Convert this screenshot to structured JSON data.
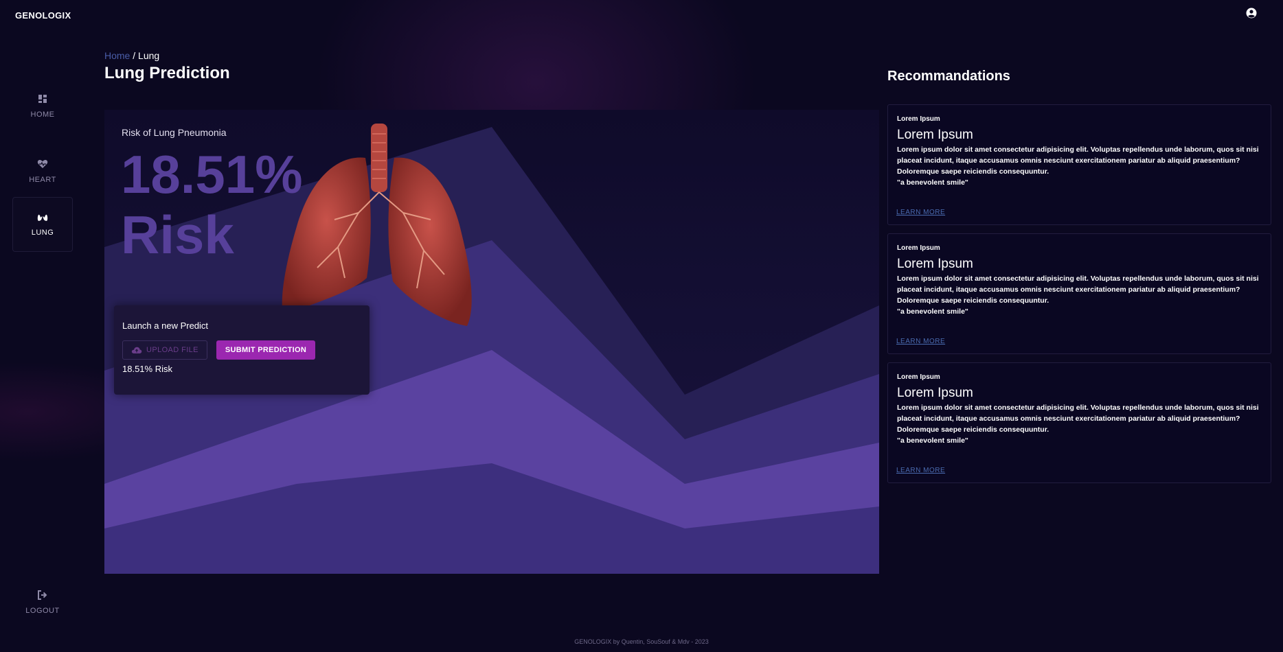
{
  "app": {
    "brand": "GENOLOGIX"
  },
  "sidebar": {
    "items": [
      {
        "label": "HOME",
        "icon": "dashboard-icon"
      },
      {
        "label": "HEART",
        "icon": "heart-pulse-icon"
      },
      {
        "label": "LUNG",
        "icon": "lungs-icon",
        "active": true
      }
    ],
    "logout": {
      "label": "LOGOUT",
      "icon": "logout-icon"
    }
  },
  "breadcrumb": {
    "home": "Home",
    "separator": " / ",
    "current": "Lung"
  },
  "page": {
    "title": "Lung Prediction"
  },
  "hero": {
    "risk_label": "Risk of Lung Pneumonia",
    "risk_value": "18.51%",
    "risk_word": "Risk"
  },
  "predict": {
    "title": "Launch a new Predict",
    "upload_label": "UPLOAD FILE",
    "submit_label": "SUBMIT PREDICTION",
    "result": "18.51% Risk"
  },
  "recommendations": {
    "title": "Recommandations",
    "cards": [
      {
        "kicker": "Lorem Ipsum",
        "heading": "Lorem Ipsum",
        "body": "Lorem ipsum dolor sit amet consectetur adipisicing elit. Voluptas repellendus unde laborum, quos sit nisi placeat incidunt, itaque accusamus omnis nesciunt exercitationem pariatur ab aliquid praesentium? Doloremque saepe reiciendis consequuntur.",
        "quote": "\"a benevolent smile\"",
        "link": "LEARN MORE"
      },
      {
        "kicker": "Lorem Ipsum",
        "heading": "Lorem Ipsum",
        "body": "Lorem ipsum dolor sit amet consectetur adipisicing elit. Voluptas repellendus unde laborum, quos sit nisi placeat incidunt, itaque accusamus omnis nesciunt exercitationem pariatur ab aliquid praesentium? Doloremque saepe reiciendis consequuntur.",
        "quote": "\"a benevolent smile\"",
        "link": "LEARN MORE"
      },
      {
        "kicker": "Lorem Ipsum",
        "heading": "Lorem Ipsum",
        "body": "Lorem ipsum dolor sit amet consectetur adipisicing elit. Voluptas repellendus unde laborum, quos sit nisi placeat incidunt, itaque accusamus omnis nesciunt exercitationem pariatur ab aliquid praesentium? Doloremque saepe reiciendis consequuntur.",
        "quote": "\"a benevolent smile\"",
        "link": "LEARN MORE"
      }
    ]
  },
  "footer": {
    "text": "GENOLOGIX by Quentin, SouSouf & Mdv - 2023"
  },
  "colors": {
    "background": "#0b0820",
    "accent": "#9b27b0",
    "risk_text": "#57409a",
    "link": "#4a6bb0"
  }
}
